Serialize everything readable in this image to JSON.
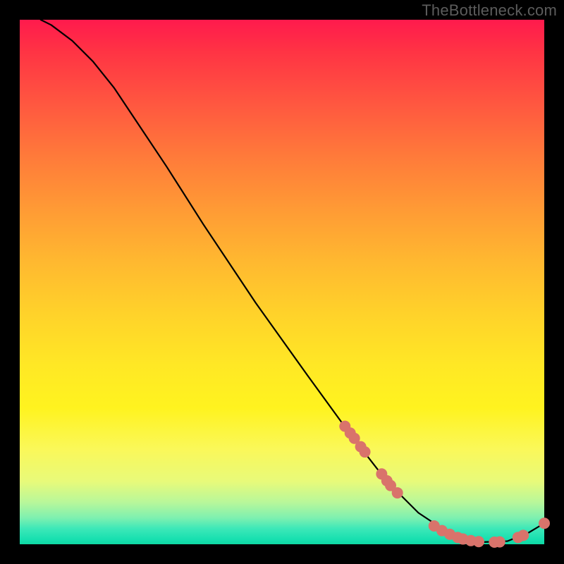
{
  "watermark": "TheBottleneck.com",
  "colors": {
    "curve_stroke": "#000000",
    "marker_fill": "#d9736b",
    "marker_stroke": "#d9736b"
  },
  "chart_data": {
    "type": "line",
    "title": "",
    "xlabel": "",
    "ylabel": "",
    "xlim": [
      0,
      100
    ],
    "ylim": [
      0,
      100
    ],
    "curve": [
      {
        "x": 4,
        "y": 100
      },
      {
        "x": 6,
        "y": 99
      },
      {
        "x": 10,
        "y": 96
      },
      {
        "x": 14,
        "y": 92
      },
      {
        "x": 18,
        "y": 87
      },
      {
        "x": 22,
        "y": 81
      },
      {
        "x": 28,
        "y": 72
      },
      {
        "x": 35,
        "y": 61
      },
      {
        "x": 45,
        "y": 46
      },
      {
        "x": 55,
        "y": 32
      },
      {
        "x": 63,
        "y": 21
      },
      {
        "x": 70,
        "y": 12
      },
      {
        "x": 76,
        "y": 6
      },
      {
        "x": 82,
        "y": 2
      },
      {
        "x": 88,
        "y": 0.4
      },
      {
        "x": 93,
        "y": 0.6
      },
      {
        "x": 97,
        "y": 2.2
      },
      {
        "x": 100,
        "y": 4
      }
    ],
    "markers": [
      {
        "x": 62,
        "y": 22.5
      },
      {
        "x": 63,
        "y": 21.2
      },
      {
        "x": 63.8,
        "y": 20.2
      },
      {
        "x": 65,
        "y": 18.6
      },
      {
        "x": 65.8,
        "y": 17.6
      },
      {
        "x": 69,
        "y": 13.4
      },
      {
        "x": 70,
        "y": 12.1
      },
      {
        "x": 70.7,
        "y": 11.2
      },
      {
        "x": 72,
        "y": 9.8
      },
      {
        "x": 79,
        "y": 3.5
      },
      {
        "x": 80.5,
        "y": 2.6
      },
      {
        "x": 82,
        "y": 1.9
      },
      {
        "x": 83.5,
        "y": 1.3
      },
      {
        "x": 84.5,
        "y": 1.0
      },
      {
        "x": 86,
        "y": 0.7
      },
      {
        "x": 87.5,
        "y": 0.5
      },
      {
        "x": 90.5,
        "y": 0.4
      },
      {
        "x": 91.5,
        "y": 0.45
      },
      {
        "x": 95,
        "y": 1.3
      },
      {
        "x": 96,
        "y": 1.7
      },
      {
        "x": 100,
        "y": 4.0
      }
    ]
  }
}
